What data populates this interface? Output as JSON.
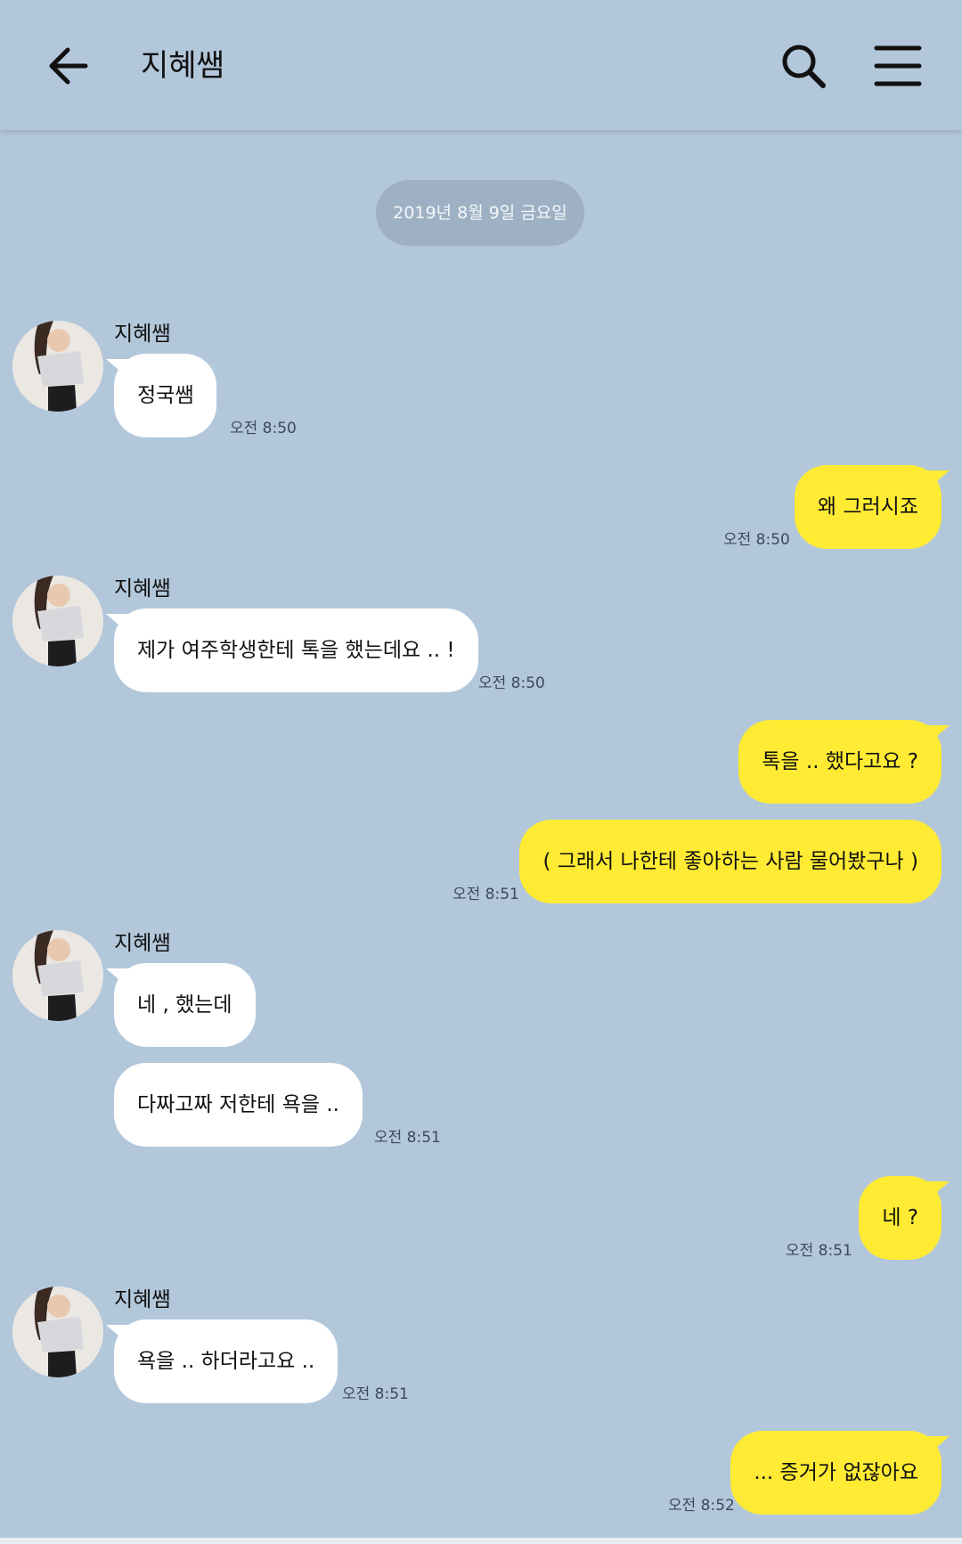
{
  "header": {
    "title": "지혜쌤",
    "back_icon": "arrow-left-icon",
    "search_icon": "search-icon",
    "menu_icon": "hamburger-menu-icon"
  },
  "date_divider": "2019년 8월 9일 금요일",
  "colors": {
    "background": "#b2c7da",
    "incoming_bubble": "#ffffff",
    "outgoing_bubble": "#ffeb33",
    "date_pill": "#9eb1c4"
  },
  "messages": [
    {
      "dir": "in",
      "sender": "지혜쌤",
      "text": "정국쌤",
      "time": "오전 8:50"
    },
    {
      "dir": "out",
      "text": "왜 그러시죠",
      "time": "오전 8:50"
    },
    {
      "dir": "in",
      "sender": "지혜쌤",
      "text": "제가 여주학생한테 톡을 했는데요 .. !",
      "time": "오전 8:50"
    },
    {
      "dir": "out",
      "text": "톡을 .. 했다고요 ?"
    },
    {
      "dir": "out",
      "text": "( 그래서 나한테 좋아하는 사람 물어봤구나 )",
      "time": "오전 8:51"
    },
    {
      "dir": "in",
      "sender": "지혜쌤",
      "text": "네 , 했는데"
    },
    {
      "dir": "in",
      "text": "다짜고짜 저한테 욕을 ..",
      "time": "오전 8:51"
    },
    {
      "dir": "out",
      "text": "네 ?",
      "time": "오전 8:51"
    },
    {
      "dir": "in",
      "sender": "지혜쌤",
      "text": "욕을 .. 하더라고요 ..",
      "time": "오전 8:51"
    },
    {
      "dir": "out",
      "text": "... 증거가 없잖아요",
      "time": "오전 8:52"
    }
  ]
}
